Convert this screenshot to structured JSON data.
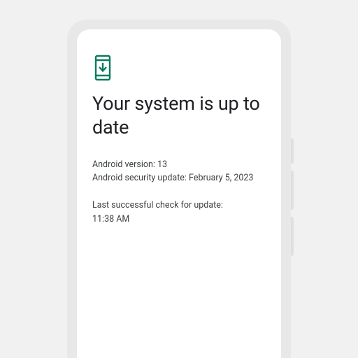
{
  "icon": {
    "name": "system-update-icon",
    "color": "#0b7a5e"
  },
  "title": "Your system is up to date",
  "details": {
    "android_version_line": "Android version: 13",
    "security_update_line": "Android security update: February 5, 2023",
    "last_check_label": "Last successful check for update:",
    "last_check_time": "11:38 AM"
  }
}
